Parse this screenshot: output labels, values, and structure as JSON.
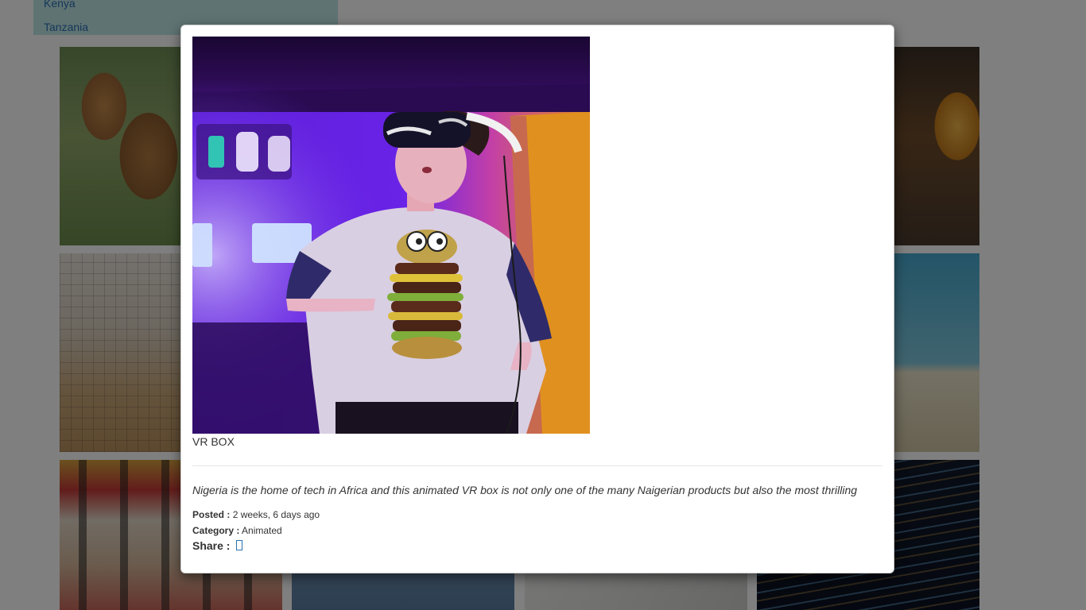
{
  "background": {
    "countries": [
      "Kenya",
      "Tanzania"
    ],
    "gallery": [
      {
        "name": "giraffe-photo"
      },
      {
        "name": "minion-photo"
      },
      {
        "name": "volleyball-photo"
      },
      {
        "name": "beach-photo"
      },
      {
        "name": "runners-photo"
      },
      {
        "name": "dress-photo"
      },
      {
        "name": "gadget-photo"
      },
      {
        "name": "code-photo"
      }
    ]
  },
  "modal": {
    "image_alt_name": "vr-headset-photo",
    "title": "VR BOX",
    "description": "Nigeria is the home of tech in Africa and this animated VR box is not only one of the many Naigerian products but also the most thrilling",
    "posted_label": "Posted :",
    "posted_value": "2 weeks, 6 days ago",
    "category_label": "Category :",
    "category_value": "Animated",
    "share_label": "Share :",
    "share_icon": "share-icon"
  },
  "colors": {
    "link": "#2a6fb0",
    "dropdown_bg": "#bfe6e6",
    "overlay": "rgba(0,0,0,0.5)"
  }
}
